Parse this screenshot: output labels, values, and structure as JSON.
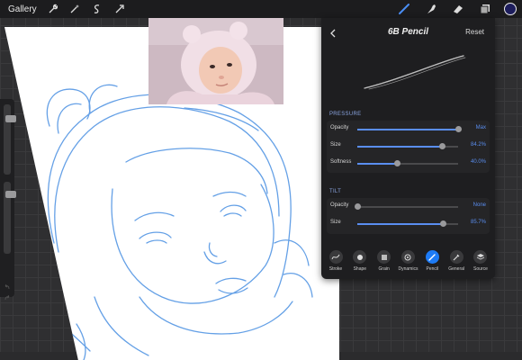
{
  "topbar": {
    "gallery_label": "Gallery",
    "left_icons": [
      "wrench-icon",
      "magic-wand-icon",
      "selection-icon",
      "transform-icon"
    ],
    "right_icons": [
      "brush-icon",
      "smudge-icon",
      "eraser-icon",
      "layers-icon"
    ],
    "color_well": "#1d1d5c",
    "active_tool_color": "#4a8ef5"
  },
  "brush_panel": {
    "title": "6B Pencil",
    "reset_label": "Reset",
    "pressure": {
      "label": "PRESSURE",
      "rows": [
        {
          "label": "Opacity",
          "value": "Max",
          "fraction": 1.0
        },
        {
          "label": "Size",
          "value": "84.2%",
          "fraction": 0.842
        },
        {
          "label": "Softness",
          "value": "40.0%",
          "fraction": 0.4
        }
      ]
    },
    "tilt": {
      "label": "TILT",
      "rows": [
        {
          "label": "Opacity",
          "value": "None",
          "fraction": 0.0
        },
        {
          "label": "Size",
          "value": "85.7%",
          "fraction": 0.857
        }
      ]
    },
    "tabs": [
      {
        "label": "Stroke",
        "icon": "stroke-icon",
        "active": false
      },
      {
        "label": "Shape",
        "icon": "shape-icon",
        "active": false
      },
      {
        "label": "Grain",
        "icon": "grain-icon",
        "active": false
      },
      {
        "label": "Dynamics",
        "icon": "dynamics-icon",
        "active": false
      },
      {
        "label": "Pencil",
        "icon": "pencil-icon",
        "active": true
      },
      {
        "label": "General",
        "icon": "general-icon",
        "active": false
      },
      {
        "label": "Source",
        "icon": "source-icon",
        "active": false
      }
    ]
  },
  "sidebar": {
    "brush_size_level": 0.9,
    "opacity_level": 0.85
  },
  "colors": {
    "accent": "#1d7bf5",
    "slider_fill": "#5a8ef0",
    "sketch_line": "#4a90e2"
  }
}
